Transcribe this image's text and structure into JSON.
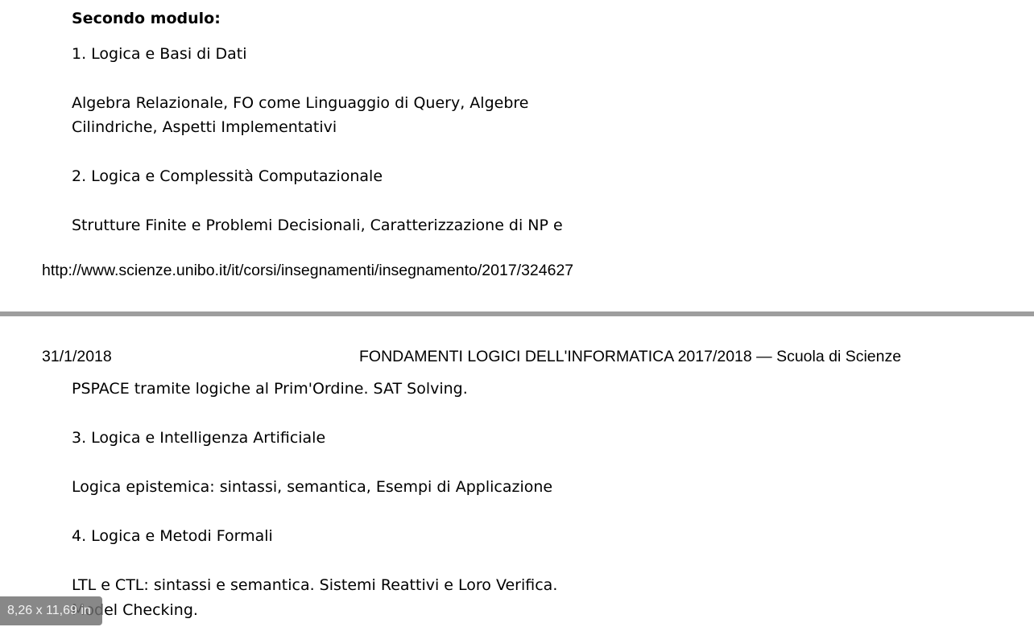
{
  "page_top": {
    "section_heading": "Secondo modulo:",
    "item1_title": "1. Logica e Basi di Dati",
    "item1_desc_line1": "Algebra Relazionale, FO come Linguaggio di Query, Algebre",
    "item1_desc_line2": "Cilindriche, Aspetti Implementativi",
    "item2_title": "2. Logica e Complessità Computazionale",
    "item2_desc_line1": "Strutture Finite e Problemi Decisionali, Caratterizzazione di NP e",
    "footer_url": "http://www.scienze.unibo.it/it/corsi/insegnamenti/insegnamento/2017/324627"
  },
  "page_bottom": {
    "header_date": "31/1/2018",
    "header_title": "FONDAMENTI LOGICI DELL'INFORMATICA 2017/2018 — Scuola di Scienze",
    "item2_desc_line2": "PSPACE tramite logiche al Prim'Ordine. SAT Solving.",
    "item3_title": "3. Logica e Intelligenza Artificiale",
    "item3_desc": "Logica epistemica: sintassi, semantica, Esempi di Applicazione",
    "item4_title": "4. Logica e Metodi Formali",
    "item4_desc_line1": "LTL e CTL: sintassi e semantica. Sistemi Reattivi e Loro Verifica.",
    "item4_desc_line2": "Model Checking."
  },
  "page_size_indicator": "8,26 x 11,69 in"
}
